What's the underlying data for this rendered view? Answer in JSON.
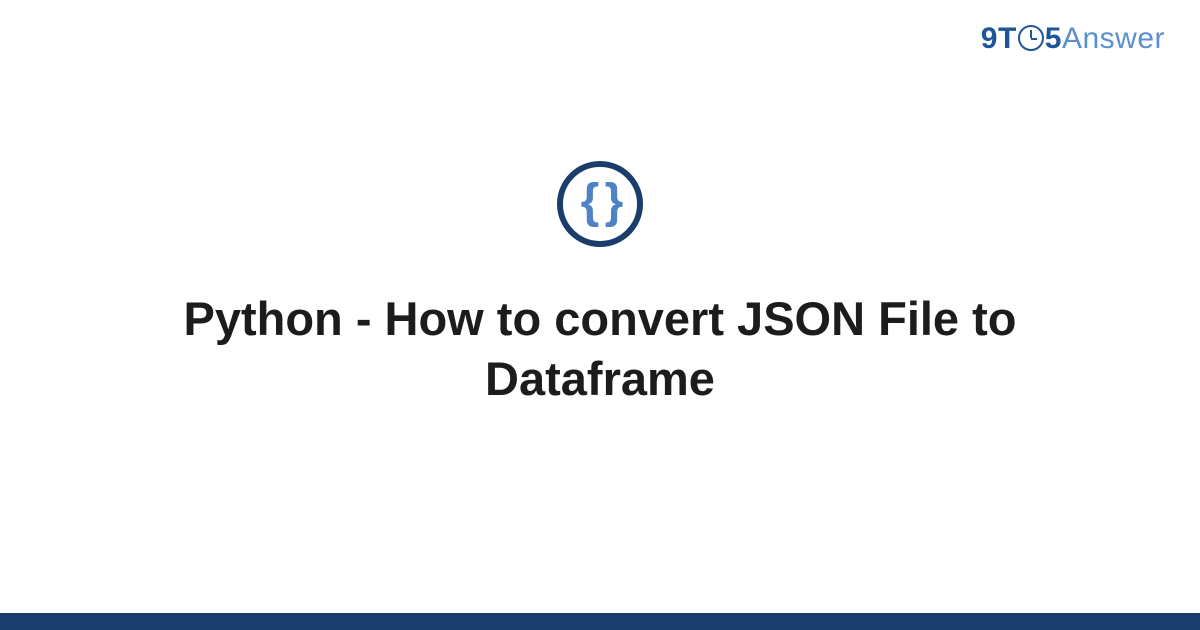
{
  "logo": {
    "nine": "9",
    "t": "T",
    "five": "5",
    "answer": "Answer"
  },
  "icon": {
    "braces": "{ }"
  },
  "title": "Python - How to convert JSON File to Dataframe"
}
